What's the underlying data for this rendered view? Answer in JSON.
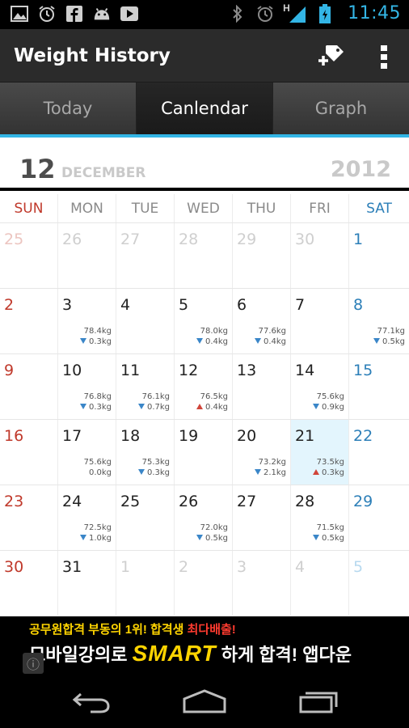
{
  "status_bar": {
    "time": "11:45",
    "network_label": "H",
    "left_icons": [
      "image-icon",
      "alarm-icon",
      "facebook-icon",
      "android-icon",
      "youtube-icon"
    ],
    "right_icons": [
      "bluetooth-icon",
      "alarm-icon",
      "signal-icon",
      "battery-icon"
    ]
  },
  "action_bar": {
    "title": "Weight History",
    "actions": [
      "add-tag-icon",
      "overflow-menu-icon"
    ]
  },
  "tabs": [
    {
      "label": "Today",
      "active": false
    },
    {
      "label": "Canlendar",
      "active": true
    },
    {
      "label": "Graph",
      "active": false
    }
  ],
  "calendar": {
    "day": "12",
    "month": "DECEMBER",
    "year": "2012",
    "weekdays": [
      "SUN",
      "MON",
      "TUE",
      "WED",
      "THU",
      "FRI",
      "SAT"
    ],
    "weeks": [
      [
        {
          "day": "25",
          "other": true
        },
        {
          "day": "26",
          "other": true
        },
        {
          "day": "27",
          "other": true
        },
        {
          "day": "28",
          "other": true
        },
        {
          "day": "29",
          "other": true
        },
        {
          "day": "30",
          "other": true
        },
        {
          "day": "1"
        }
      ],
      [
        {
          "day": "2"
        },
        {
          "day": "3",
          "weight": "78.4kg",
          "change": "0.3kg",
          "dir": "down"
        },
        {
          "day": "4"
        },
        {
          "day": "5",
          "weight": "78.0kg",
          "change": "0.4kg",
          "dir": "down"
        },
        {
          "day": "6",
          "weight": "77.6kg",
          "change": "0.4kg",
          "dir": "down"
        },
        {
          "day": "7"
        },
        {
          "day": "8",
          "weight": "77.1kg",
          "change": "0.5kg",
          "dir": "down"
        }
      ],
      [
        {
          "day": "9"
        },
        {
          "day": "10",
          "weight": "76.8kg",
          "change": "0.3kg",
          "dir": "down"
        },
        {
          "day": "11",
          "weight": "76.1kg",
          "change": "0.7kg",
          "dir": "down"
        },
        {
          "day": "12",
          "weight": "76.5kg",
          "change": "0.4kg",
          "dir": "up"
        },
        {
          "day": "13"
        },
        {
          "day": "14",
          "weight": "75.6kg",
          "change": "0.9kg",
          "dir": "down"
        },
        {
          "day": "15"
        }
      ],
      [
        {
          "day": "16"
        },
        {
          "day": "17",
          "weight": "75.6kg",
          "change": "0.0kg",
          "dir": "none"
        },
        {
          "day": "18",
          "weight": "75.3kg",
          "change": "0.3kg",
          "dir": "down"
        },
        {
          "day": "19"
        },
        {
          "day": "20",
          "weight": "73.2kg",
          "change": "2.1kg",
          "dir": "down"
        },
        {
          "day": "21",
          "weight": "73.5kg",
          "change": "0.3kg",
          "dir": "up",
          "today": true
        },
        {
          "day": "22"
        }
      ],
      [
        {
          "day": "23"
        },
        {
          "day": "24",
          "weight": "72.5kg",
          "change": "1.0kg",
          "dir": "down"
        },
        {
          "day": "25"
        },
        {
          "day": "26",
          "weight": "72.0kg",
          "change": "0.5kg",
          "dir": "down"
        },
        {
          "day": "27"
        },
        {
          "day": "28",
          "weight": "71.5kg",
          "change": "0.5kg",
          "dir": "down"
        },
        {
          "day": "29"
        }
      ],
      [
        {
          "day": "30"
        },
        {
          "day": "31"
        },
        {
          "day": "1",
          "other": true
        },
        {
          "day": "2",
          "other": true
        },
        {
          "day": "3",
          "other": true
        },
        {
          "day": "4",
          "other": true
        },
        {
          "day": "5",
          "other": true
        }
      ]
    ]
  },
  "ad": {
    "line1_prefix": "공무원합격 부동의 1위! 합격생 ",
    "line1_highlight": "최다배출!",
    "line2_prefix": "모바일강의로 ",
    "line2_brand": "SMART",
    "line2_suffix": " 하게 합격! 앱다운",
    "info_icon": "info-icon"
  },
  "nav_bar": {
    "buttons": [
      "back-icon",
      "home-icon",
      "recent-apps-icon"
    ]
  },
  "colors": {
    "accent": "#33b5e5",
    "sunday": "#c0392b",
    "saturday": "#2c7fb8",
    "today_bg": "#e3f5fd",
    "down_arrow": "#3a86c8",
    "up_arrow": "#d0453a"
  }
}
